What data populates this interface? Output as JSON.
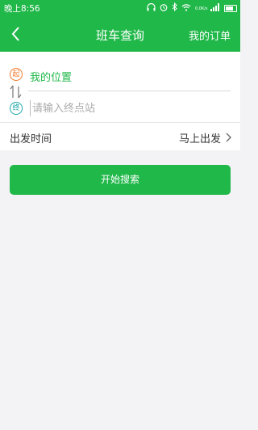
{
  "status_bar": {
    "time": "晚上8:56",
    "net_speed": "0.0K/s"
  },
  "header": {
    "title": "班车查询",
    "orders_label": "我的订单"
  },
  "route": {
    "start_badge": "起",
    "end_badge": "终",
    "start_location": "我的位置",
    "destination_placeholder": "请输入终点站",
    "destination_value": ""
  },
  "departure": {
    "label": "出发时间",
    "value": "马上出发"
  },
  "search_button_label": "开始搜索",
  "colors": {
    "accent": "#21b84a",
    "start_badge": "#f07a2b",
    "end_badge": "#21a8a8"
  },
  "icons": [
    "back-arrow-icon",
    "swap-icon",
    "chevron-right-icon",
    "headphones-icon",
    "alarm-icon",
    "bluetooth-icon",
    "wifi-icon",
    "signal-icon",
    "battery-icon"
  ]
}
